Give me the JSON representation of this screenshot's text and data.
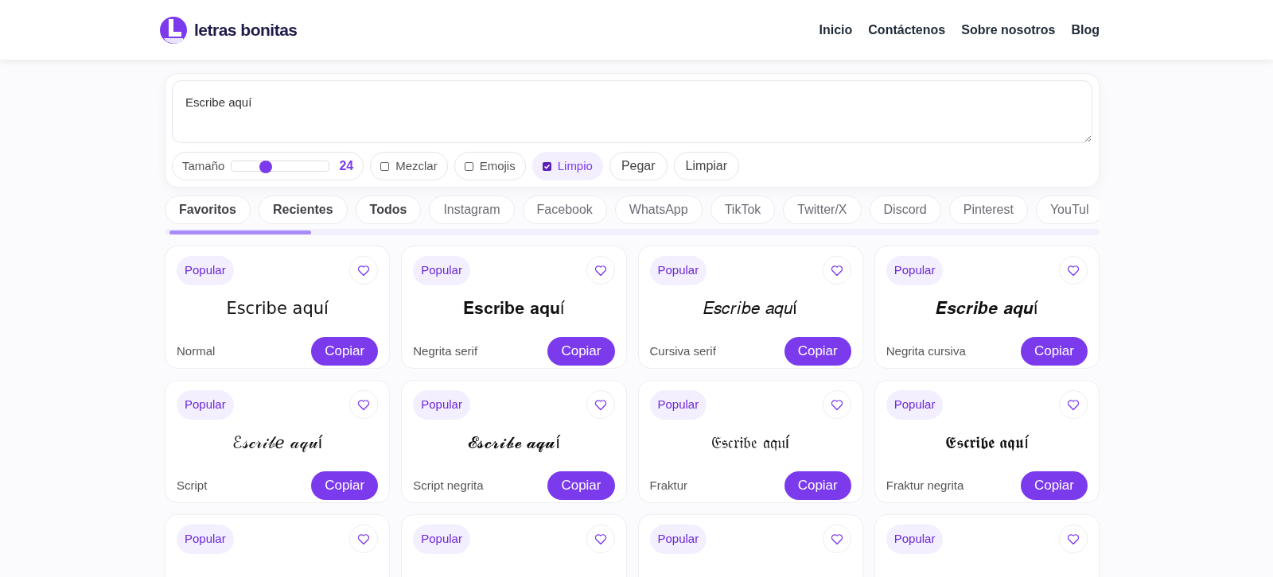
{
  "header": {
    "logo_text": "letras bonitas",
    "nav": [
      {
        "label": "Inicio"
      },
      {
        "label": "Contáctenos"
      },
      {
        "label": "Sobre nosotros"
      },
      {
        "label": "Blog"
      }
    ]
  },
  "editor": {
    "value": "Escribe aquí",
    "size": {
      "label": "Tamaño",
      "level": 0.35,
      "reading": "24"
    },
    "options": [
      {
        "kind": "checkbox",
        "label": "Mezclar",
        "checked": false
      },
      {
        "kind": "checkbox",
        "label": "Emojis",
        "checked": false
      },
      {
        "kind": "checkbox",
        "label": "Limpio",
        "checked": true
      },
      {
        "kind": "button",
        "label": "Pegar"
      },
      {
        "kind": "button",
        "label": "Limpiar"
      }
    ]
  },
  "categories": [
    {
      "kind": "collection",
      "label": "Favoritos"
    },
    {
      "kind": "collection",
      "label": "Recientes"
    },
    {
      "kind": "collection",
      "label": "Todos"
    },
    {
      "kind": "platform",
      "label": "Instagram"
    },
    {
      "kind": "platform",
      "label": "Facebook"
    },
    {
      "kind": "platform",
      "label": "WhatsApp"
    },
    {
      "kind": "platform",
      "label": "TikTok"
    },
    {
      "kind": "platform",
      "label": "Twitter/X"
    },
    {
      "kind": "platform",
      "label": "Discord"
    },
    {
      "kind": "platform",
      "label": "Pinterest"
    },
    {
      "kind": "platform",
      "label": "YouTul"
    }
  ],
  "cards": [
    {
      "badge": "Popular",
      "preview": "Escribe aquí",
      "name": "Normal",
      "button": "Copiar"
    },
    {
      "badge": "Popular",
      "preview": "𝐄𝐬𝐜𝐫𝐢𝐛𝐞 𝐚𝐪𝐮í",
      "name": "Negrita serif",
      "button": "Copiar"
    },
    {
      "badge": "Popular",
      "preview": "𝐸𝑠𝑐𝑟𝑖𝑏𝑒 𝑎𝑞𝑢í",
      "name": "Cursiva serif",
      "button": "Copiar"
    },
    {
      "badge": "Popular",
      "preview": "𝑬𝒔𝒄𝒓𝒊𝒃𝒆 𝒂𝒒𝒖í",
      "name": "Negrita cursiva",
      "button": "Copiar"
    },
    {
      "badge": "Popular",
      "preview": "ℰ𝓈𝒸𝓇𝒾𝒷ℯ 𝒶𝓆𝓊í",
      "name": "Script",
      "button": "Copiar"
    },
    {
      "badge": "Popular",
      "preview": "𝓔𝓼𝓬𝓻𝓲𝓫𝓮 𝓪𝓺𝓾í",
      "name": "Script negrita",
      "button": "Copiar"
    },
    {
      "badge": "Popular",
      "preview": "𝔈𝔰𝔠𝔯𝔦𝔟𝔢 𝔞𝔮𝔲í",
      "name": "Fraktur",
      "button": "Copiar"
    },
    {
      "badge": "Popular",
      "preview": "𝕰𝖘𝖈𝖗𝖎𝖇𝖊 𝖆𝖖𝖚í",
      "name": "Fraktur negrita",
      "button": "Copiar"
    },
    {
      "badge": "Popular"
    },
    {
      "badge": "Popular"
    },
    {
      "badge": "Popular"
    },
    {
      "badge": "Popular"
    }
  ]
}
